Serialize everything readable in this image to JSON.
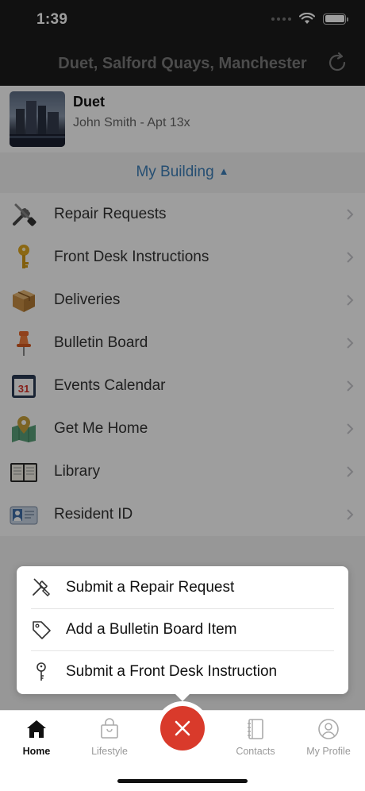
{
  "status_bar": {
    "time": "1:39"
  },
  "nav": {
    "title": "Duet, Salford Quays, Manchester",
    "refresh_icon": "refresh-icon"
  },
  "building": {
    "name": "Duet",
    "resident": "John Smith - Apt 13x"
  },
  "section": {
    "label": "My Building",
    "caret": "▲"
  },
  "menu": {
    "items": [
      {
        "label": "Repair Requests",
        "icon": "tools-icon"
      },
      {
        "label": "Front Desk Instructions",
        "icon": "key-icon"
      },
      {
        "label": "Deliveries",
        "icon": "package-icon"
      },
      {
        "label": "Bulletin Board",
        "icon": "pushpin-icon"
      },
      {
        "label": "Events Calendar",
        "icon": "calendar-icon",
        "badge": "31"
      },
      {
        "label": "Get Me Home",
        "icon": "map-pin-icon"
      },
      {
        "label": "Library",
        "icon": "book-icon"
      },
      {
        "label": "Resident ID",
        "icon": "id-card-icon"
      }
    ]
  },
  "action_sheet": {
    "items": [
      {
        "label": "Submit a Repair Request",
        "icon": "wrench-screwdriver-icon"
      },
      {
        "label": "Add a Bulletin Board Item",
        "icon": "tag-icon"
      },
      {
        "label": "Submit a Front Desk Instruction",
        "icon": "key-icon"
      }
    ]
  },
  "tab_bar": {
    "tabs": [
      {
        "label": "Home",
        "icon": "home-icon",
        "active": true
      },
      {
        "label": "Lifestyle",
        "icon": "shopping-bag-icon",
        "active": false
      },
      {
        "label": "Contacts",
        "icon": "address-book-icon",
        "active": false
      },
      {
        "label": "My Profile",
        "icon": "user-circle-icon",
        "active": false
      }
    ],
    "fab_icon": "close-icon"
  },
  "colors": {
    "accent": "#3d7fb8",
    "fab": "#d93a2b",
    "header": "#1c1c1c"
  }
}
